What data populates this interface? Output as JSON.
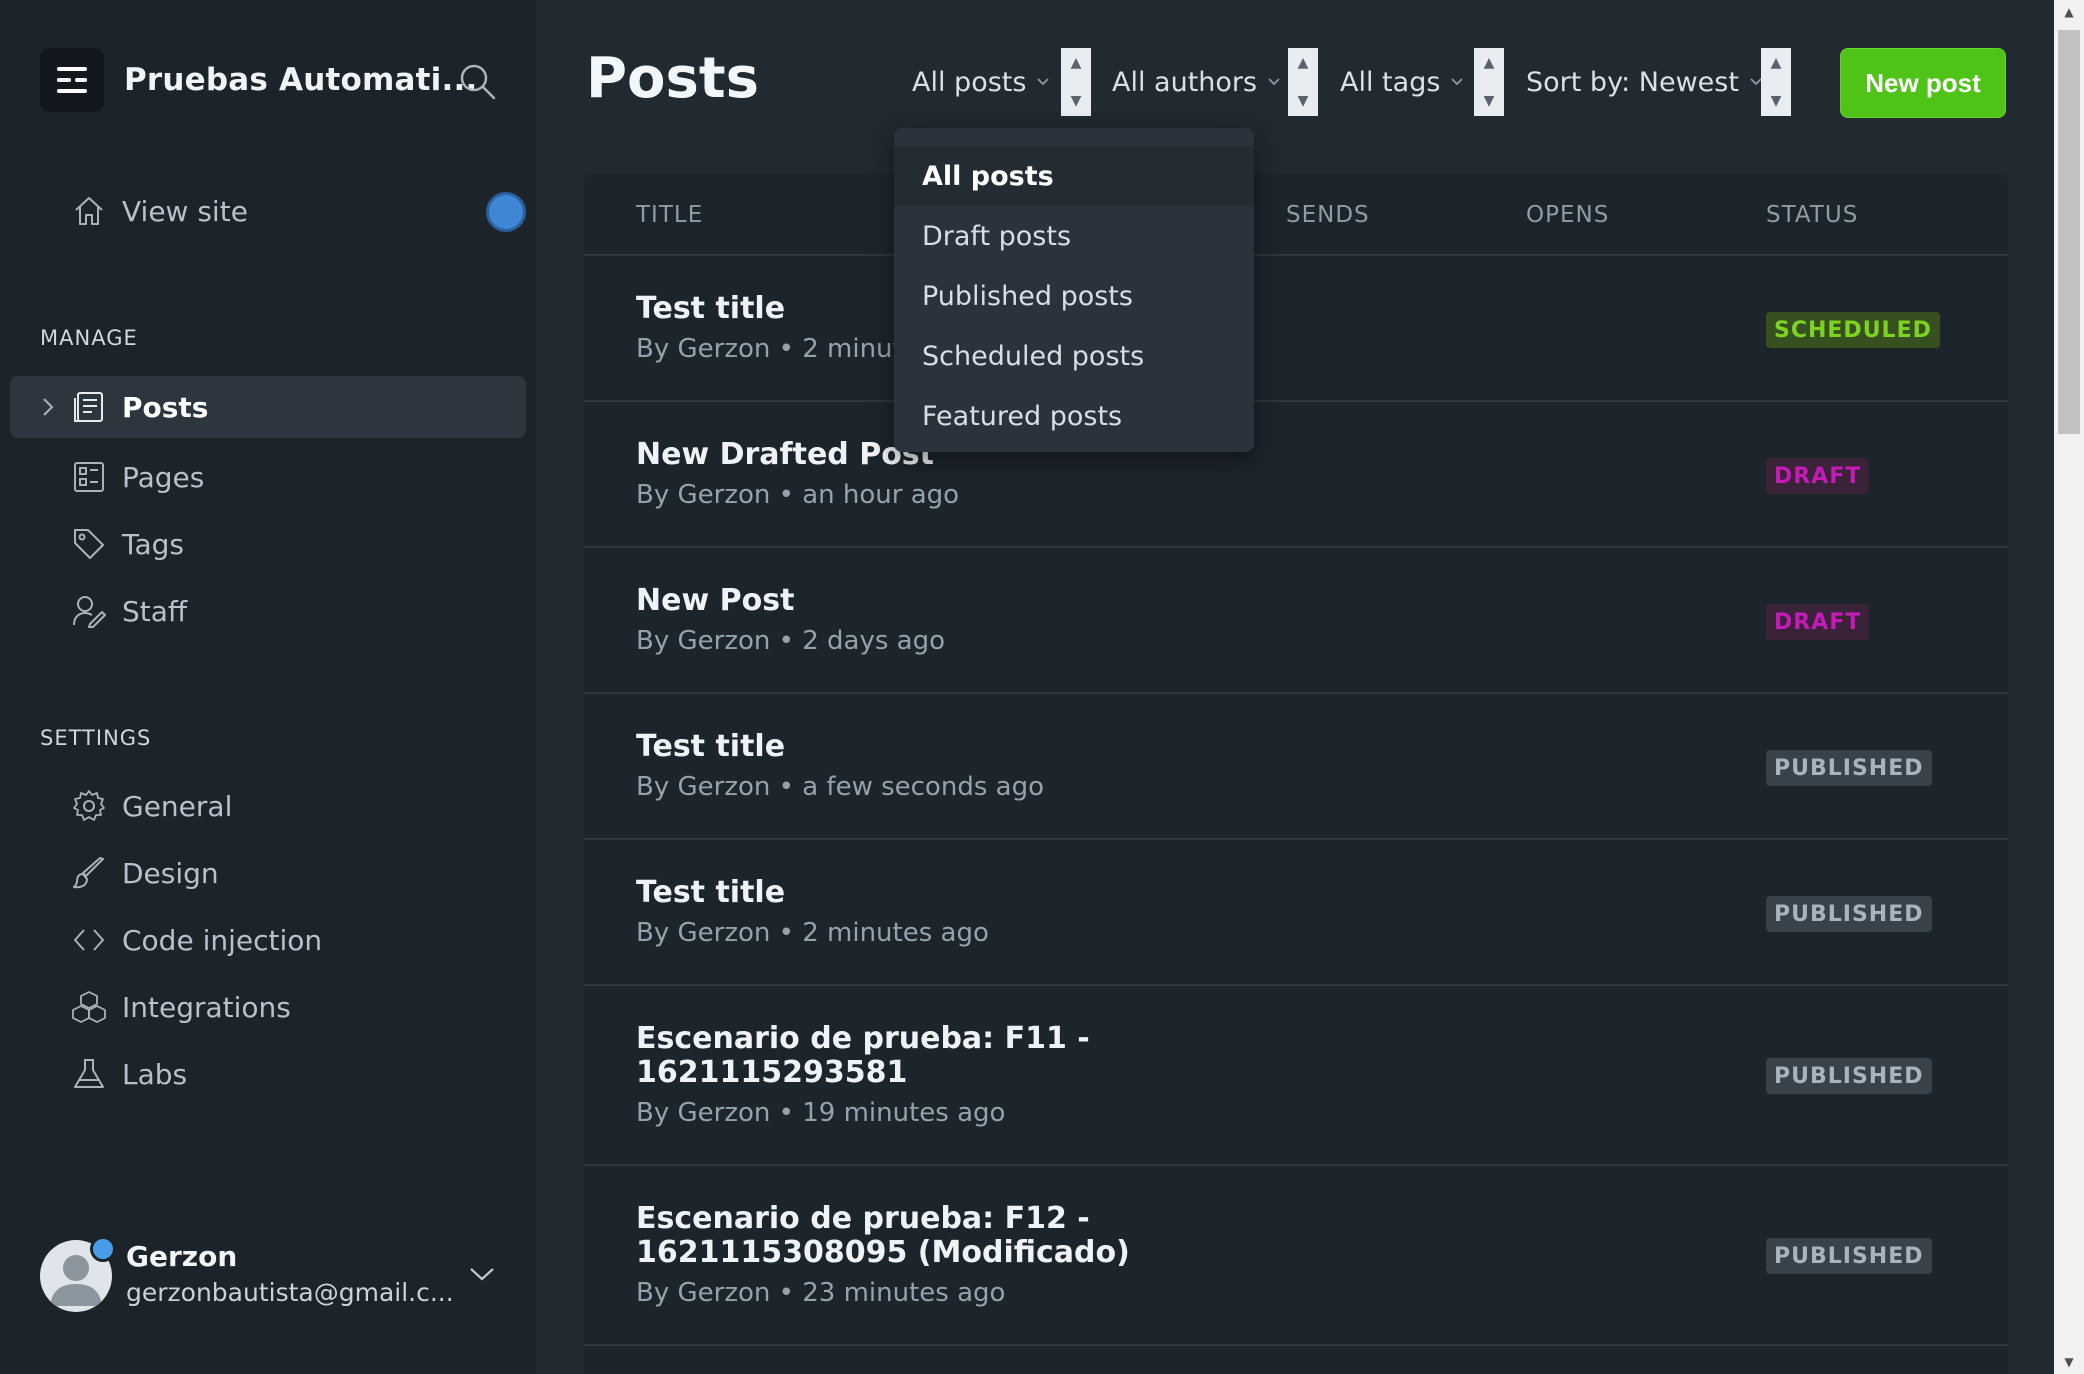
{
  "sidebar": {
    "site_title": "Pruebas Automati...",
    "view_site": "View site",
    "manage_heading": "MANAGE",
    "manage_items": [
      {
        "label": "Posts",
        "icon": "posts-icon",
        "active": true
      },
      {
        "label": "Pages",
        "icon": "pages-icon"
      },
      {
        "label": "Tags",
        "icon": "tag-icon"
      },
      {
        "label": "Staff",
        "icon": "staff-icon"
      }
    ],
    "settings_heading": "SETTINGS",
    "settings_items": [
      {
        "label": "General",
        "icon": "gear-icon"
      },
      {
        "label": "Design",
        "icon": "brush-icon"
      },
      {
        "label": "Code injection",
        "icon": "code-icon"
      },
      {
        "label": "Integrations",
        "icon": "integrations-icon"
      },
      {
        "label": "Labs",
        "icon": "flask-icon"
      }
    ],
    "user": {
      "name": "Gerzon",
      "email": "gerzonbautista@gmail.c..."
    }
  },
  "header": {
    "title": "Posts",
    "filters": {
      "type": "All posts",
      "author": "All authors",
      "tags": "All tags",
      "sort": "Sort by: Newest"
    },
    "new_post": "New post"
  },
  "dropdown": {
    "options": [
      "All posts",
      "Draft posts",
      "Published posts",
      "Scheduled posts",
      "Featured posts"
    ],
    "selected": "All posts"
  },
  "table": {
    "columns": {
      "title": "TITLE",
      "sends": "SENDS",
      "opens": "OPENS",
      "status": "STATUS"
    },
    "rows": [
      {
        "title": "Test title",
        "meta": "By Gerzon • 2 minute",
        "status": "SCHEDULED"
      },
      {
        "title": "New Drafted Post",
        "meta": "By Gerzon • an hour ago",
        "status": "DRAFT"
      },
      {
        "title": "New Post",
        "meta": "By Gerzon • 2 days ago",
        "status": "DRAFT"
      },
      {
        "title": "Test title",
        "meta": "By Gerzon • a few seconds ago",
        "status": "PUBLISHED"
      },
      {
        "title": "Test title",
        "meta": "By Gerzon • 2 minutes ago",
        "status": "PUBLISHED"
      },
      {
        "title_line1": "Escenario de prueba: F11 -",
        "title_line2": "1621115293581",
        "meta": "By Gerzon • 19 minutes ago",
        "status": "PUBLISHED"
      },
      {
        "title_line1": "Escenario de prueba: F12 -",
        "title_line2": "1621115308095 (Modificado)",
        "meta": "By Gerzon • 23 minutes ago",
        "status": "PUBLISHED"
      }
    ]
  },
  "colors": {
    "accent_green": "#4fc317",
    "scheduled": "#7ed321",
    "draft": "#c51ab8",
    "published": "#a8b3bd"
  }
}
